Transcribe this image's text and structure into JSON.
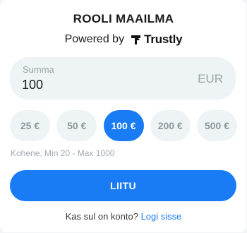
{
  "header": {
    "title": "ROOLI MAAILMA",
    "powered_by": "Powered by",
    "brand": "Trustly"
  },
  "amount": {
    "label": "Summa",
    "value": "100",
    "currency": "EUR"
  },
  "chips": [
    {
      "label": "25 €",
      "selected": false
    },
    {
      "label": "50 €",
      "selected": false
    },
    {
      "label": "100 €",
      "selected": true
    },
    {
      "label": "200 €",
      "selected": false
    },
    {
      "label": "500 €",
      "selected": false
    }
  ],
  "limits_text": "Kohene, Min 20 - Max 1000",
  "deposit_button": "LIITU",
  "login": {
    "prompt": "Kas sul on konto?",
    "link": "Logi sisse"
  },
  "colors": {
    "accent": "#1a7cf5",
    "field_bg": "#eef4f6"
  },
  "icons": {
    "brand_logo": "trustly-logo-icon"
  }
}
